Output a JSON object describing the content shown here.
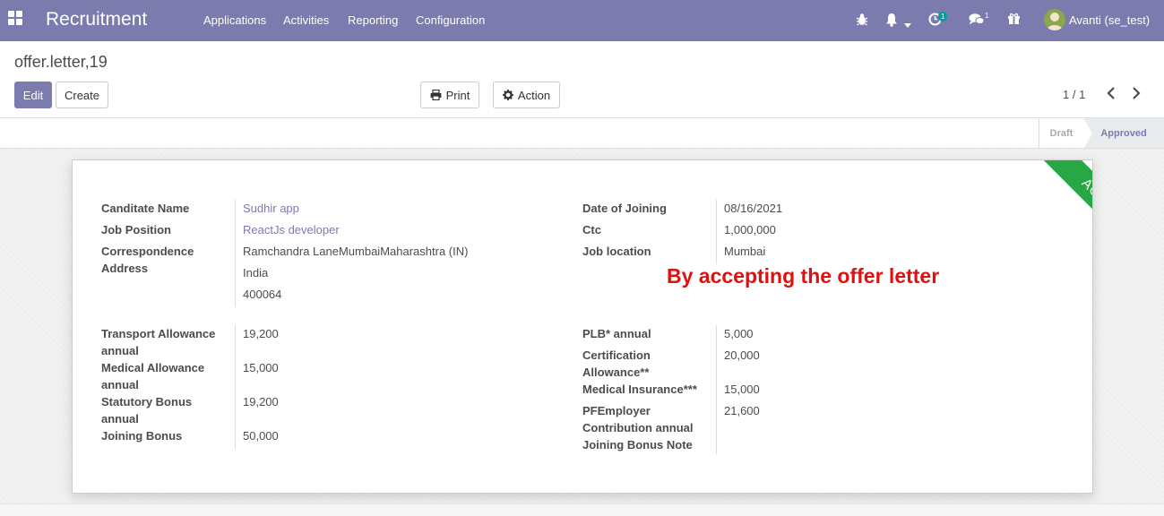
{
  "navbar": {
    "app_name": "Recruitment",
    "menu": [
      "Applications",
      "Activities",
      "Reporting",
      "Configuration"
    ],
    "activity_badge": "1",
    "messages_count": "1",
    "user_name": "Avanti (se_test)"
  },
  "control": {
    "breadcrumb": "offer.letter,19",
    "edit_label": "Edit",
    "create_label": "Create",
    "print_label": "Print",
    "action_label": "Action",
    "pager": "1 / 1"
  },
  "statusbar": {
    "stages": [
      "Draft",
      "Approved"
    ],
    "active_stage": "Approved"
  },
  "sheet": {
    "ribbon": "ACCEPTED",
    "note": "By accepting the offer letter",
    "left_top": {
      "candidate_label": "Canditate Name",
      "candidate_value": "Sudhir app",
      "job_position_label": "Job Position",
      "job_position_value": "ReactJs developer",
      "address_label_1": "Correspondence",
      "address_label_2": "Address",
      "address_line_1": "Ramchandra LaneMumbaiMaharashtra (IN)",
      "address_line_2": "India",
      "address_line_3": "400064"
    },
    "right_top": {
      "doj_label": "Date of Joining",
      "doj_value": "08/16/2021",
      "ctc_label": "Ctc",
      "ctc_value": "1,000,000",
      "job_location_label": "Job location",
      "job_location_value": "Mumbai"
    },
    "left_bottom": {
      "transport_label_1": "Transport Allowance",
      "transport_label_2": "annual",
      "transport_value": "19,200",
      "medical_label_1": "Medical Allowance",
      "medical_label_2": "annual",
      "medical_value": "15,000",
      "statutory_label_1": "Statutory Bonus",
      "statutory_label_2": "annual",
      "statutory_value": "19,200",
      "joining_label": "Joining Bonus",
      "joining_value": "50,000"
    },
    "right_bottom": {
      "plb_label": "PLB* annual",
      "plb_value": "5,000",
      "cert_label_1": "Certification",
      "cert_label_2": "Allowance**",
      "cert_value": "20,000",
      "insurance_label": "Medical Insurance***",
      "insurance_value": "15,000",
      "pf_label_1": "PFEmployer",
      "pf_label_2": "Contribution annual",
      "pf_value": "21,600",
      "joining_note_label": "Joining Bonus Note"
    }
  }
}
